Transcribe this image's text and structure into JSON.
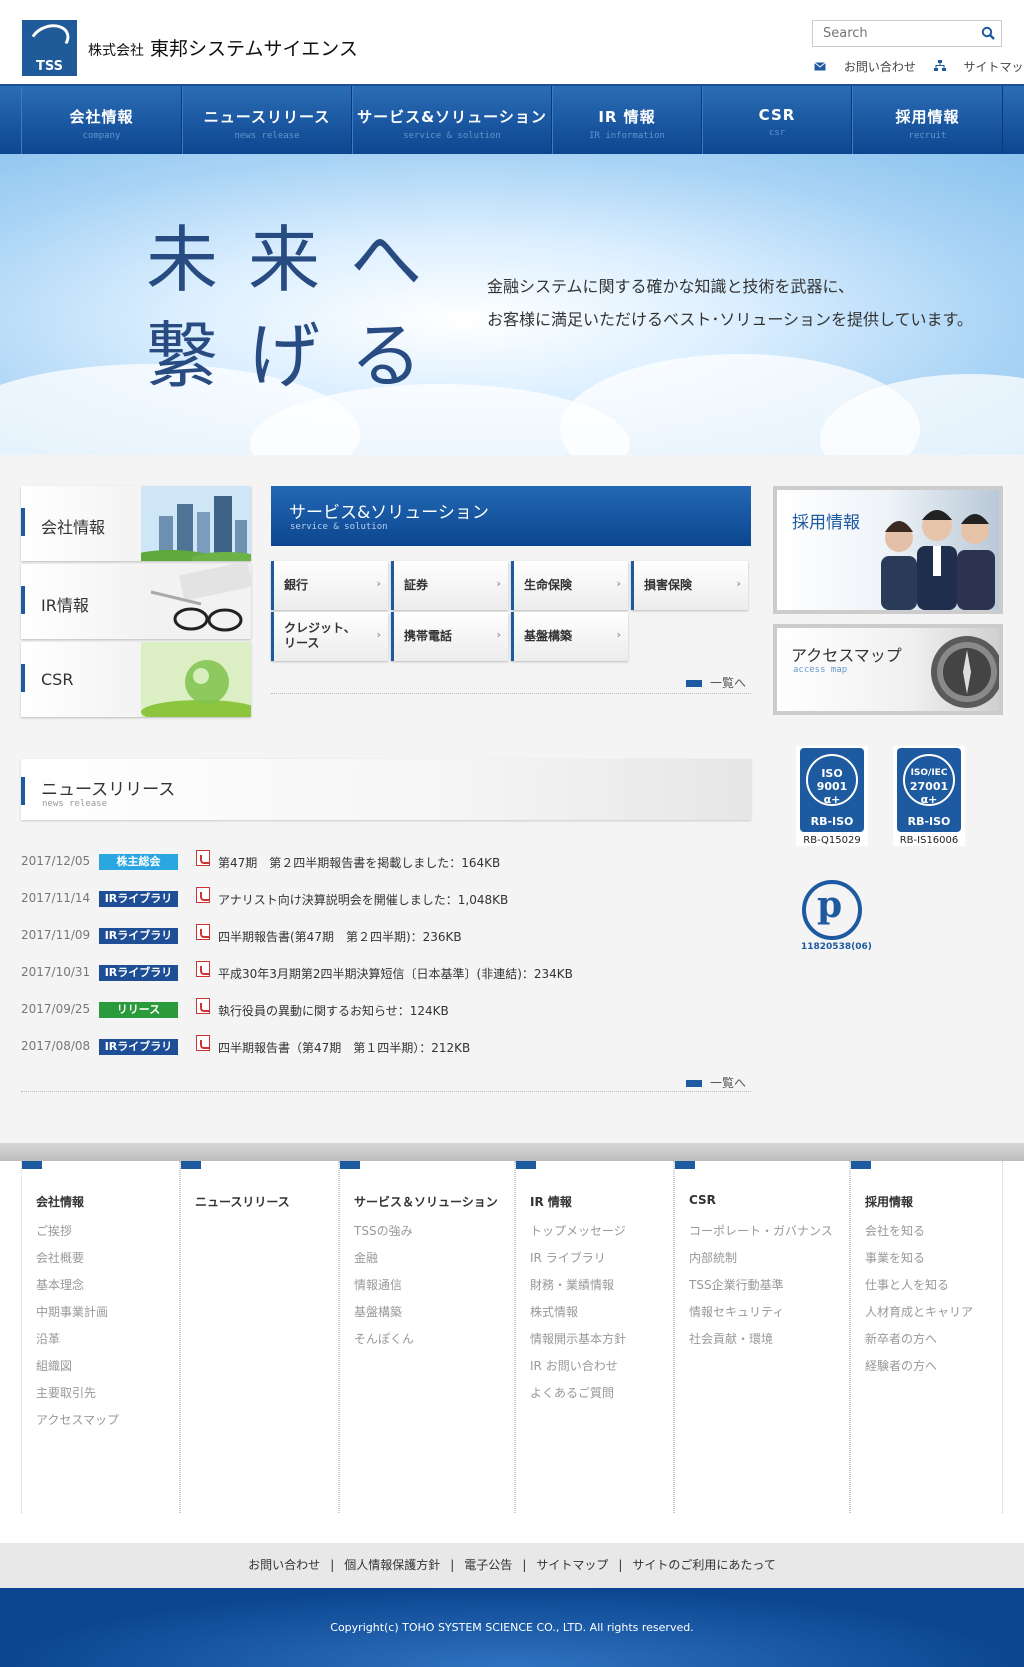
{
  "header": {
    "logo_text": "TSS",
    "company_prefix": "株式会社",
    "company_name": "東邦システムサイエンス",
    "search_placeholder": "Search",
    "contact_link": "お問い合わせ",
    "sitemap_link": "サイトマップ"
  },
  "nav": [
    {
      "jp": "会社情報",
      "en": "company"
    },
    {
      "jp": "ニュースリリース",
      "en": "news release"
    },
    {
      "jp": "サービス&ソリューション",
      "en": "service & solution"
    },
    {
      "jp": "IR 情報",
      "en": "IR information"
    },
    {
      "jp": "CSR",
      "en": "csr"
    },
    {
      "jp": "採用情報",
      "en": "recruit"
    }
  ],
  "hero": {
    "title_line1": "未来へ",
    "title_line2": "繋げる",
    "sub_line1": "金融システムに関する確かな知識と技術を武器に、",
    "sub_line2": "お客様に満足いただけるベスト･ソリューションを提供しています。"
  },
  "left_boxes": [
    {
      "label": "会社情報"
    },
    {
      "label": "IR情報"
    },
    {
      "label": "CSR"
    }
  ],
  "services": {
    "title": "サービス&ソリューション",
    "subtitle": "service & solution",
    "items": [
      {
        "label": "銀行"
      },
      {
        "label": "証券"
      },
      {
        "label": "生命保険"
      },
      {
        "label": "損害保険"
      },
      {
        "label": "クレジット、\nリース"
      },
      {
        "label": "携帯電話"
      },
      {
        "label": "基盤構築"
      }
    ],
    "more": "一覧へ"
  },
  "recruit": {
    "title": "採用情報"
  },
  "access": {
    "title": "アクセスマップ",
    "subtitle": "access map"
  },
  "iso": [
    {
      "line1": "ISO",
      "line2": "9001",
      "line3": "α+",
      "mark": "RB-ISO",
      "code": "RB-Q15029"
    },
    {
      "line1": "ISO/IEC",
      "line2": "27001",
      "line3": "α+",
      "mark": "RB-ISO",
      "code": "RB-IS16006"
    }
  ],
  "privacy_mark": {
    "number": "11820538(06)"
  },
  "news": {
    "title": "ニュースリリース",
    "subtitle": "news release",
    "more": "一覧へ",
    "items": [
      {
        "date": "2017/12/05",
        "category": "株主総会",
        "color": "#2aa6e0",
        "text": "第47期　第２四半期報告書を掲載しました：164KB"
      },
      {
        "date": "2017/11/14",
        "category": "IRライブラリ",
        "color": "#1e4f96",
        "text": "アナリスト向け決算説明会を開催しました：1,048KB"
      },
      {
        "date": "2017/11/09",
        "category": "IRライブラリ",
        "color": "#1e4f96",
        "text": "四半期報告書(第47期　第２四半期)：236KB"
      },
      {
        "date": "2017/10/31",
        "category": "IRライブラリ",
        "color": "#1e4f96",
        "text": "平成30年3月期第2四半期決算短信〔日本基準〕(非連結)：234KB"
      },
      {
        "date": "2017/09/25",
        "category": "リリース",
        "color": "#2a9a3a",
        "text": "執行役員の異動に関するお知らせ：124KB"
      },
      {
        "date": "2017/08/08",
        "category": "IRライブラリ",
        "color": "#1e4f96",
        "text": "四半期報告書（第47期　第１四半期）：212KB"
      }
    ]
  },
  "footer_nav": [
    {
      "heading": "会社情報",
      "items": [
        "ご挨拶",
        "会社概要",
        "基本理念",
        "中期事業計画",
        "沿革",
        "組織図",
        "主要取引先",
        "アクセスマップ"
      ]
    },
    {
      "heading": "ニュースリリース",
      "items": []
    },
    {
      "heading": "サービス＆ソリューション",
      "items": [
        "TSSの強み",
        "金融",
        "情報通信",
        "基盤構築",
        "そんぽくん"
      ]
    },
    {
      "heading": "IR 情報",
      "items": [
        "トップメッセージ",
        "IR ライブラリ",
        "財務・業績情報",
        "株式情報",
        "情報開示基本方針",
        "IR お問い合わせ",
        "よくあるご質問"
      ]
    },
    {
      "heading": "CSR",
      "items": [
        "コーポレート・ガバナンス",
        "内部統制",
        "TSS企業行動基準",
        "情報セキュリティ",
        "社会貢献・環境"
      ]
    },
    {
      "heading": "採用情報",
      "items": [
        "会社を知る",
        "事業を知る",
        "仕事と人を知る",
        "人材育成とキャリア",
        "新卒者の方へ",
        "経験者の方へ"
      ]
    }
  ],
  "footer_links": [
    "お問い合わせ",
    "個人情報保護方針",
    "電子公告",
    "サイトマップ",
    "サイトのご利用にあたって"
  ],
  "copyright": "Copyright(c) TOHO SYSTEM SCIENCE CO., LTD. All rights reserved."
}
